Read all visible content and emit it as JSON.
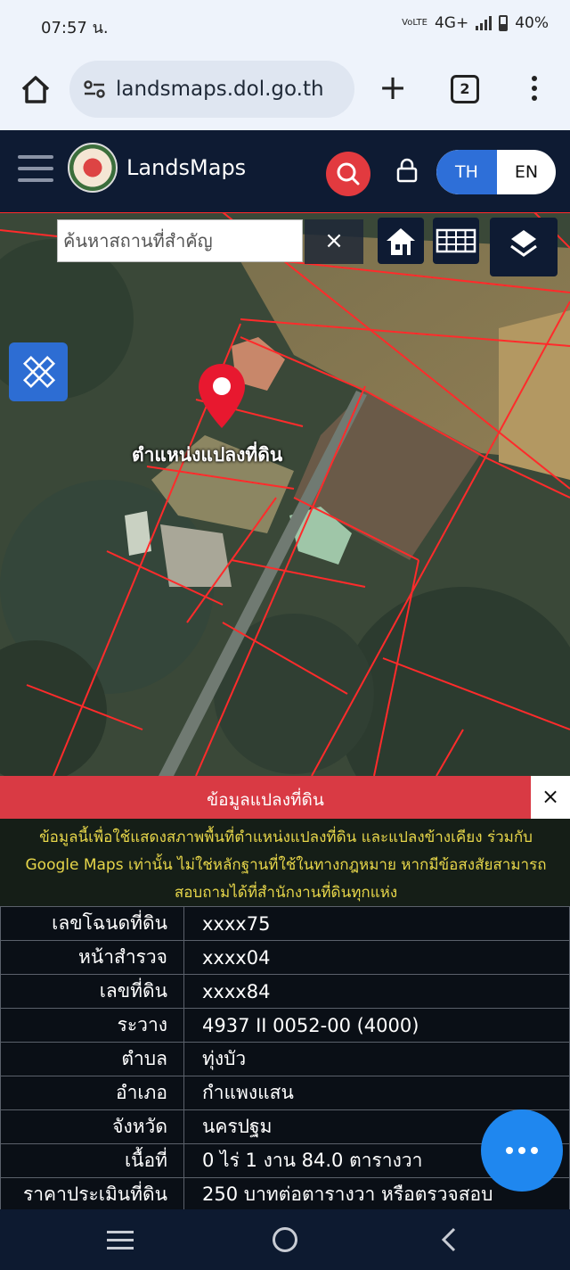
{
  "status_bar": {
    "time": "07:57 น.",
    "network": "4G+",
    "volte": "VoLTE",
    "battery": "40%"
  },
  "browser": {
    "url": "landsmaps.dol.go.th",
    "tab_count": "2"
  },
  "site": {
    "brand": "LandsMaps",
    "lang_th": "TH",
    "lang_en": "EN"
  },
  "map": {
    "search_placeholder": "ค้นหาสถานที่สำคัญ",
    "search_value": "",
    "clear_label": "×",
    "pin_label": "ตำแหน่งแปลงที่ดิน"
  },
  "parcel_panel": {
    "title": "ข้อมูลแปลงที่ดิน",
    "close_label": "×",
    "disclaimer": "ข้อมูลนี้เพื่อใช้แสดงสภาพพื้นที่ตำแหน่งแปลงที่ดิน และแปลงข้างเคียง ร่วมกับ Google Maps เท่านั้น ไม่ใช่หลักฐานที่ใช้ในทางกฎหมาย หากมีข้อสงสัยสามารถสอบถามได้ที่สำนักงานที่ดินทุกแห่ง",
    "rows": [
      {
        "label": "เลขโฉนดที่ดิน",
        "value": "xxxx75"
      },
      {
        "label": "หน้าสำรวจ",
        "value": "xxxx04"
      },
      {
        "label": "เลขที่ดิน",
        "value": "xxxx84"
      },
      {
        "label": "ระวาง",
        "value": "4937 II 0052-00 (4000)"
      },
      {
        "label": "ตำบล",
        "value": "ทุ่งบัว"
      },
      {
        "label": "อำเภอ",
        "value": "กำแพงแสน"
      },
      {
        "label": "จังหวัด",
        "value": "นครปฐม"
      },
      {
        "label": "เนื้อที่",
        "value": "0 ไร่ 1 งาน 84.0 ตารางวา"
      },
      {
        "label": "ราคาประเมินที่ดิน",
        "value": "250 บาทต่อตารางวา หรือตรวจสอบ"
      }
    ]
  },
  "colors": {
    "header_bg": "#0e1b33",
    "accent_red": "#e23a3f",
    "toggle_blue": "#2e6fd8",
    "fab_blue": "#1f87ef",
    "disclaimer_text": "#e7d64a"
  }
}
